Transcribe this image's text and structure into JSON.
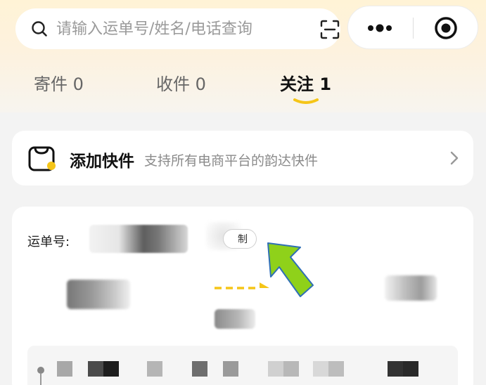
{
  "search": {
    "placeholder": "请输入运单号/姓名/电话查询"
  },
  "tabs": [
    {
      "label": "寄件 0",
      "active": false
    },
    {
      "label": "收件 0",
      "active": false
    },
    {
      "label": "关注 1",
      "active": true
    }
  ],
  "add_card": {
    "title": "添加快件",
    "subtitle": "支持所有电商平台的韵达快件"
  },
  "shipment": {
    "waybill_label": "运单号:",
    "copy_label": "制"
  },
  "colors": {
    "accent_yellow": "#f5c518",
    "arrow_green": "#8fd11a"
  }
}
